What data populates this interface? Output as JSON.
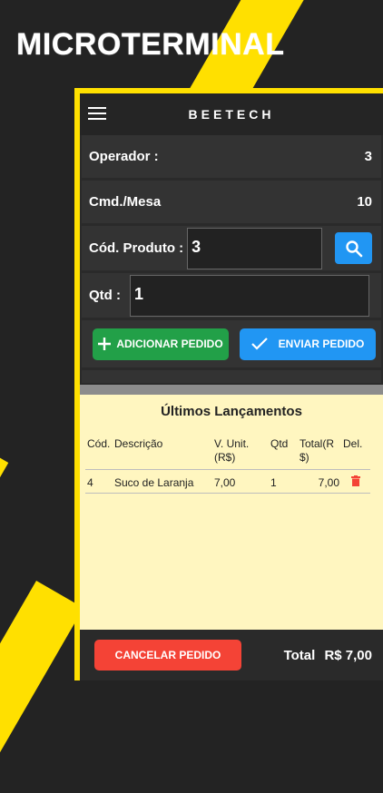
{
  "promo": {
    "title": "MICROTERMINAL"
  },
  "app": {
    "brand": "BEETECH"
  },
  "form": {
    "operator_label": "Operador :",
    "operator_value": "3",
    "table_label": "Cmd./Mesa",
    "table_value": "10",
    "product_label": "Cód. Produto :",
    "product_value": "3",
    "qty_label": "Qtd :",
    "qty_value": "1"
  },
  "actions": {
    "add_label": "ADICIONAR PEDIDO",
    "send_label": "ENVIAR PEDIDO",
    "cancel_label": "CANCELAR PEDIDO"
  },
  "recent": {
    "title": "Últimos Lançamentos",
    "columns": [
      "Cód.",
      "Descrição",
      "V. Unit. (R$)",
      "Qtd",
      "Total(R $)",
      "Del."
    ],
    "rows": [
      {
        "code": "4",
        "description": "Suco de Laranja",
        "unit_price": "7,00",
        "qty": "1",
        "total": "7,00"
      }
    ]
  },
  "footer": {
    "total_label": "Total",
    "total_value": "R$ 7,00"
  },
  "colors": {
    "accent_yellow": "#ffe000",
    "green": "#22a048",
    "blue": "#2196f3",
    "red": "#f44336"
  }
}
